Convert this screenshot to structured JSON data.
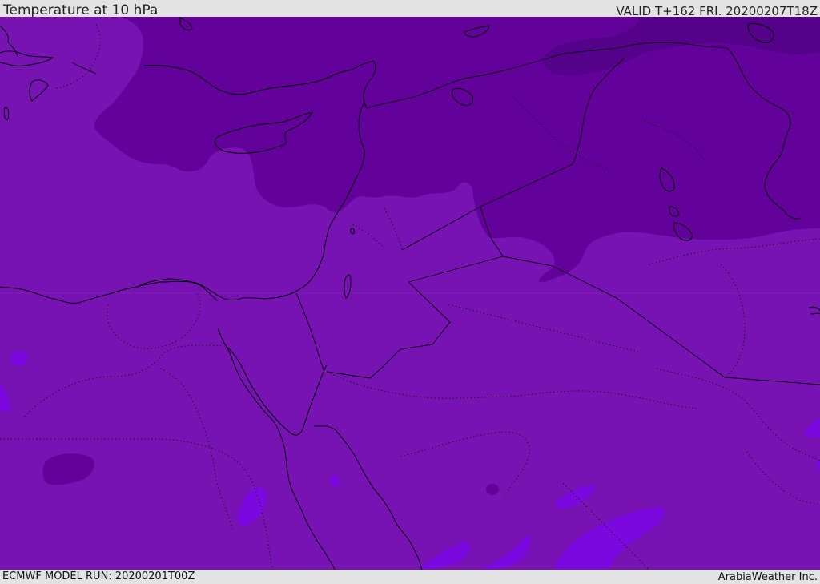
{
  "header": {
    "title": "Temperature at 10 hPa",
    "valid": "VALID T+162 FRI. 20200207T18Z"
  },
  "footer": {
    "model_run": "ECMWF MODEL RUN: 20200201T00Z",
    "credit": "ArabiaWeather Inc."
  },
  "map": {
    "field": "temperature",
    "level": "10 hPa",
    "colors": {
      "base_shade": "#7712b3",
      "cold_shade": "#63029a",
      "coldest_shade": "#55028a",
      "warm_shade": "#7b09df",
      "coastline": "#000000"
    }
  }
}
